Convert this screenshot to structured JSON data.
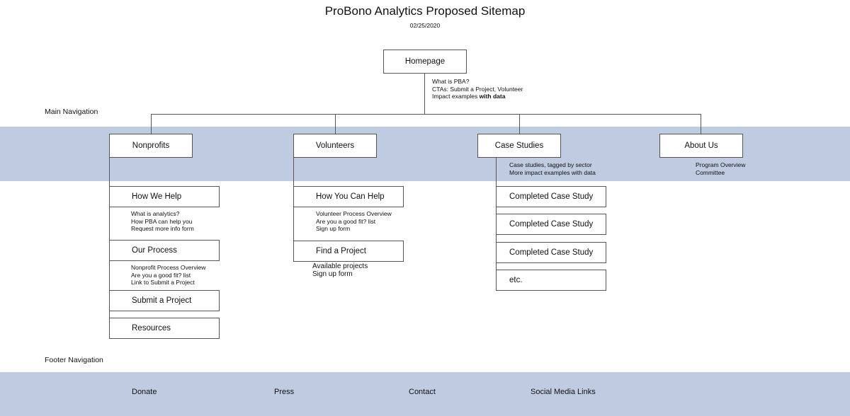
{
  "header": {
    "title": "ProBono Analytics Proposed Sitemap",
    "date": "02/25/2020"
  },
  "homepage": {
    "label": "Homepage",
    "notes": [
      "What is PBA?",
      "CTAs: Submit a Project, Volunteer",
      "Impact examples "
    ],
    "notes_bold_suffix": "with data"
  },
  "main_nav": {
    "label": "Main Navigation",
    "sections": [
      {
        "label": "Nonprofits",
        "children": [
          {
            "label": "How We Help",
            "notes": [
              "What is analytics?",
              "How PBA can help you",
              "Request more info form"
            ]
          },
          {
            "label": "Our Process",
            "notes": [
              "Nonprofit Process Overview",
              "Are you a good fit? list",
              "Link to Submit a Project"
            ]
          },
          {
            "label": "Submit a Project",
            "notes": []
          },
          {
            "label": "Resources",
            "notes": []
          }
        ]
      },
      {
        "label": "Volunteers",
        "children": [
          {
            "label": "How You Can Help",
            "notes": [
              "Volunteer Process Overview",
              "Are you a good fit? list",
              "Sign up form"
            ]
          },
          {
            "label": "Find a Project",
            "notes": [
              "Available projects",
              "Sign up form"
            ]
          }
        ]
      },
      {
        "label": "Case Studies",
        "notes": [
          "Case studies, tagged by sector",
          "More impact examples with data"
        ],
        "children": [
          {
            "label": "Completed Case Study"
          },
          {
            "label": "Completed Case Study"
          },
          {
            "label": "Completed Case Study"
          },
          {
            "label": "etc."
          }
        ]
      },
      {
        "label": "About Us",
        "notes": [
          "Program Overview",
          "Committee"
        ]
      }
    ]
  },
  "footer_nav": {
    "label": "Footer Navigation",
    "items": [
      "Donate",
      "Press",
      "Contact",
      "Social Media Links"
    ]
  },
  "colors": {
    "band": "#bfcbe1",
    "line": "#555555"
  }
}
